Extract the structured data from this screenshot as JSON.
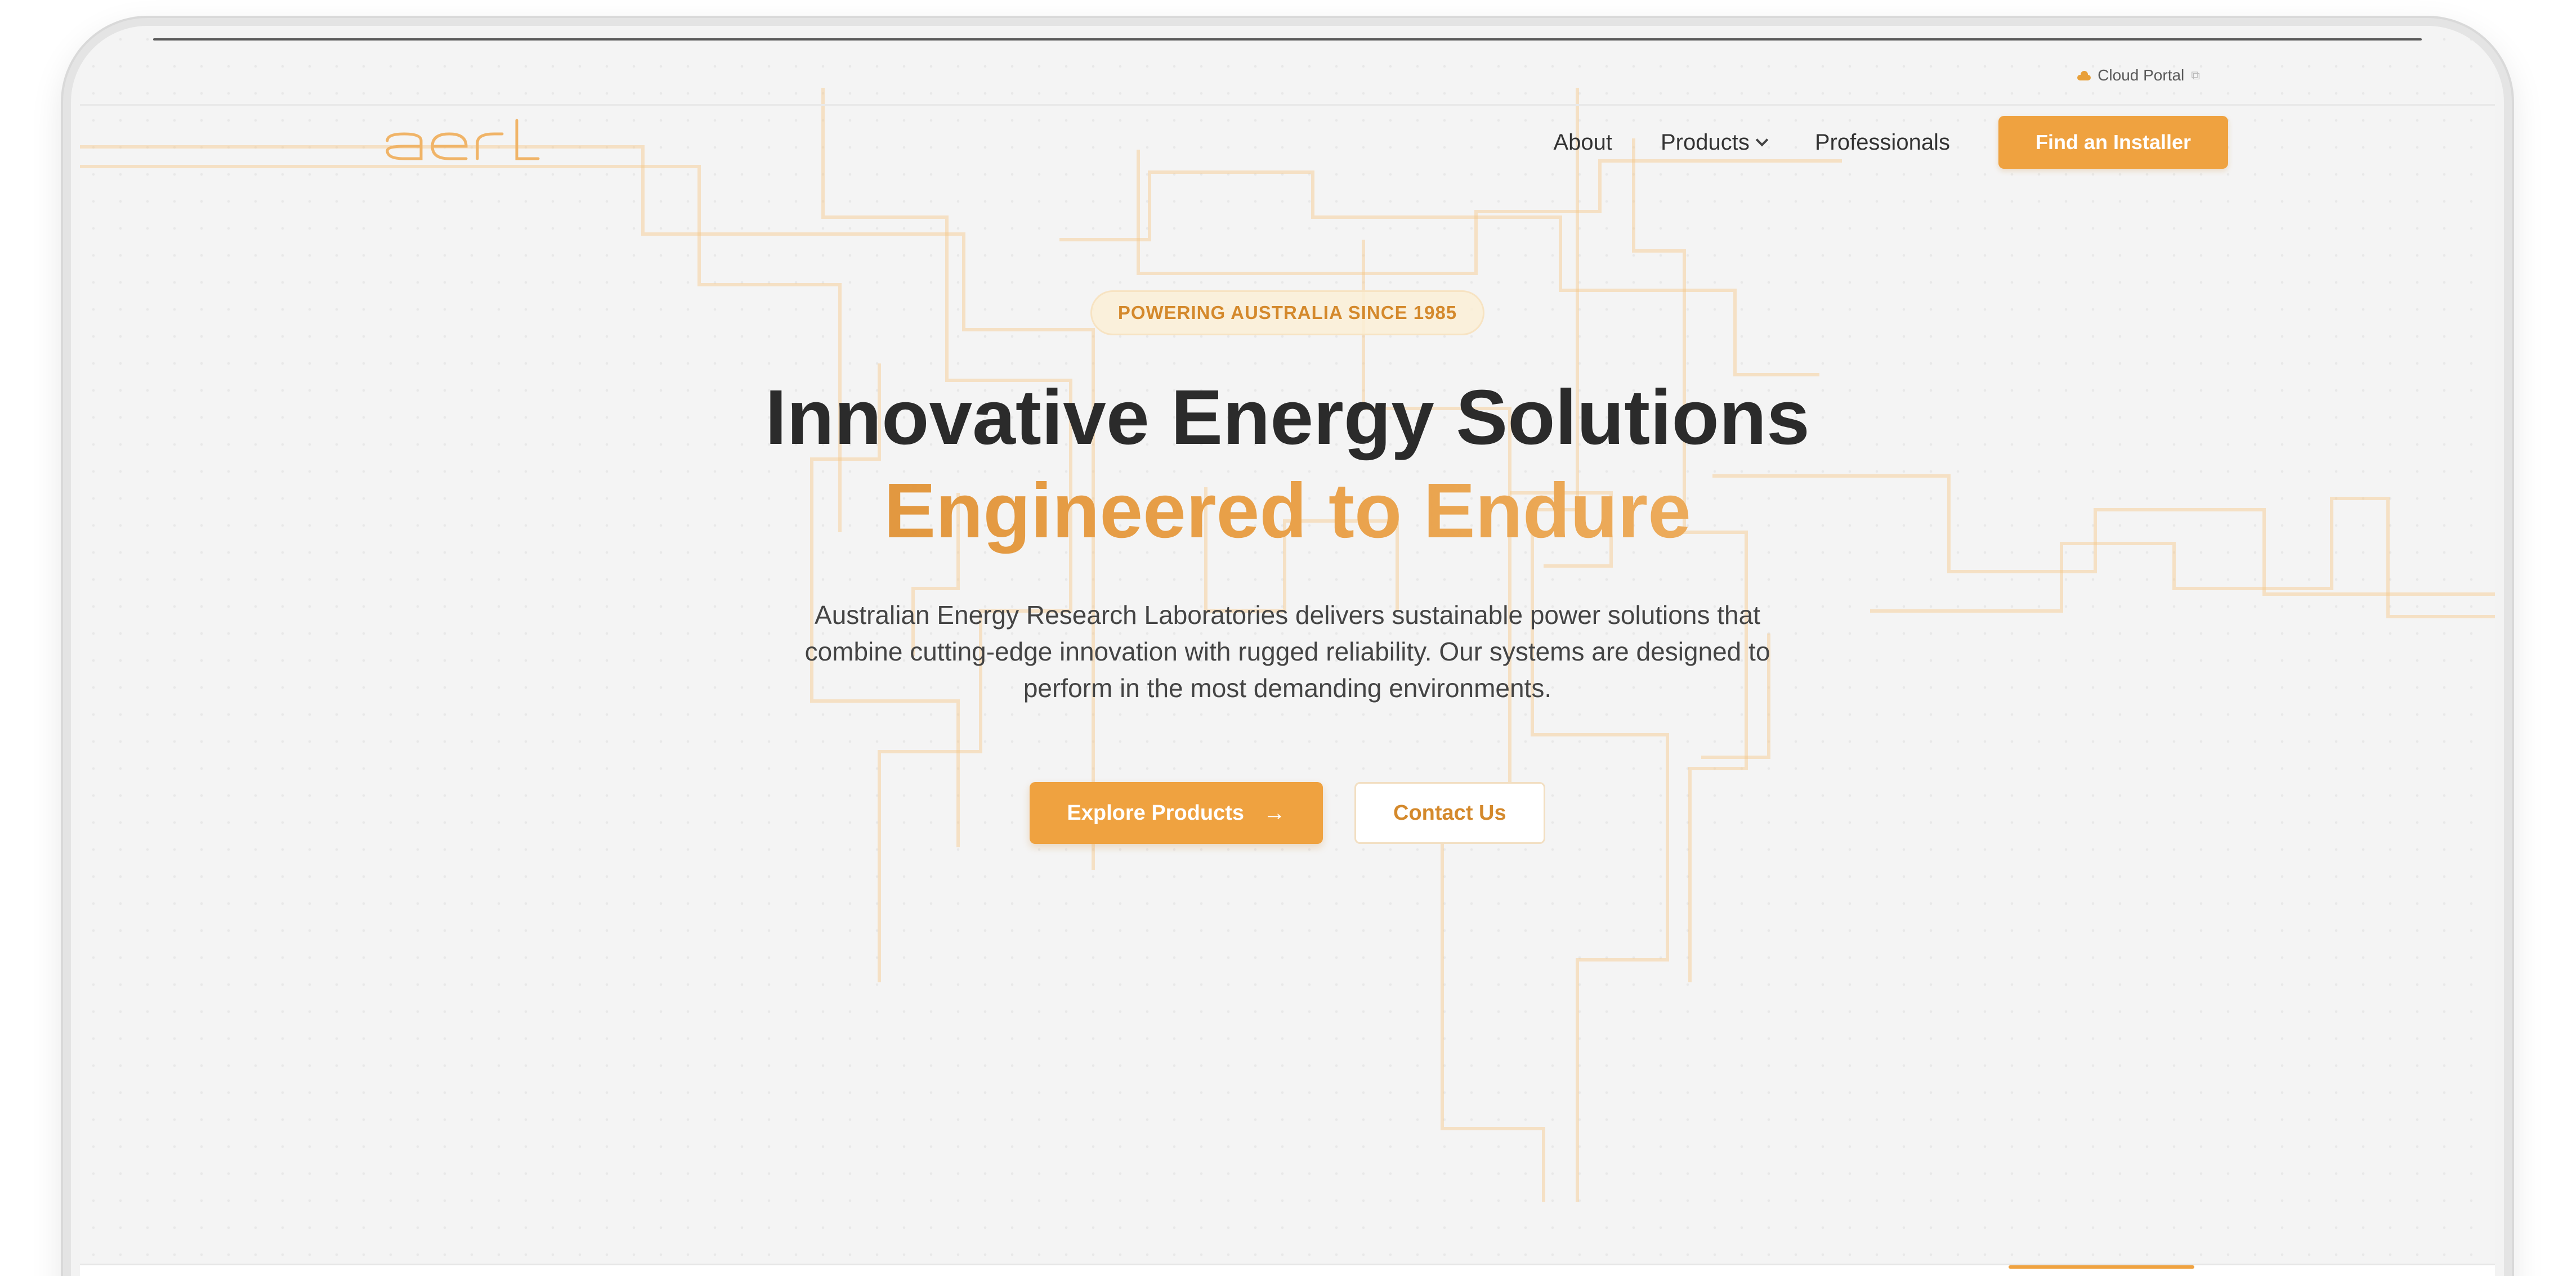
{
  "utility": {
    "cloud_portal": "Cloud Portal",
    "cloud_icon": "cloud-icon",
    "external_icon": "external-link-icon"
  },
  "brand": {
    "logo_text": "aerl",
    "accent": "#efa240",
    "accent_dark": "#d4892c"
  },
  "nav": {
    "about": "About",
    "products": "Products",
    "professionals": "Professionals",
    "cta": "Find an Installer"
  },
  "hero": {
    "badge": "POWERING AUSTRALIA SINCE 1985",
    "title_line1": "Innovative Energy Solutions",
    "title_line2": "Engineered to Endure",
    "subtitle": "Australian Energy Research Laboratories delivers sustainable power solutions that combine cutting-edge innovation with rugged reliability. Our systems are designed to perform in the most demanding environments.",
    "primary_button": "Explore Products",
    "primary_arrow": "→",
    "secondary_button": "Contact Us"
  }
}
